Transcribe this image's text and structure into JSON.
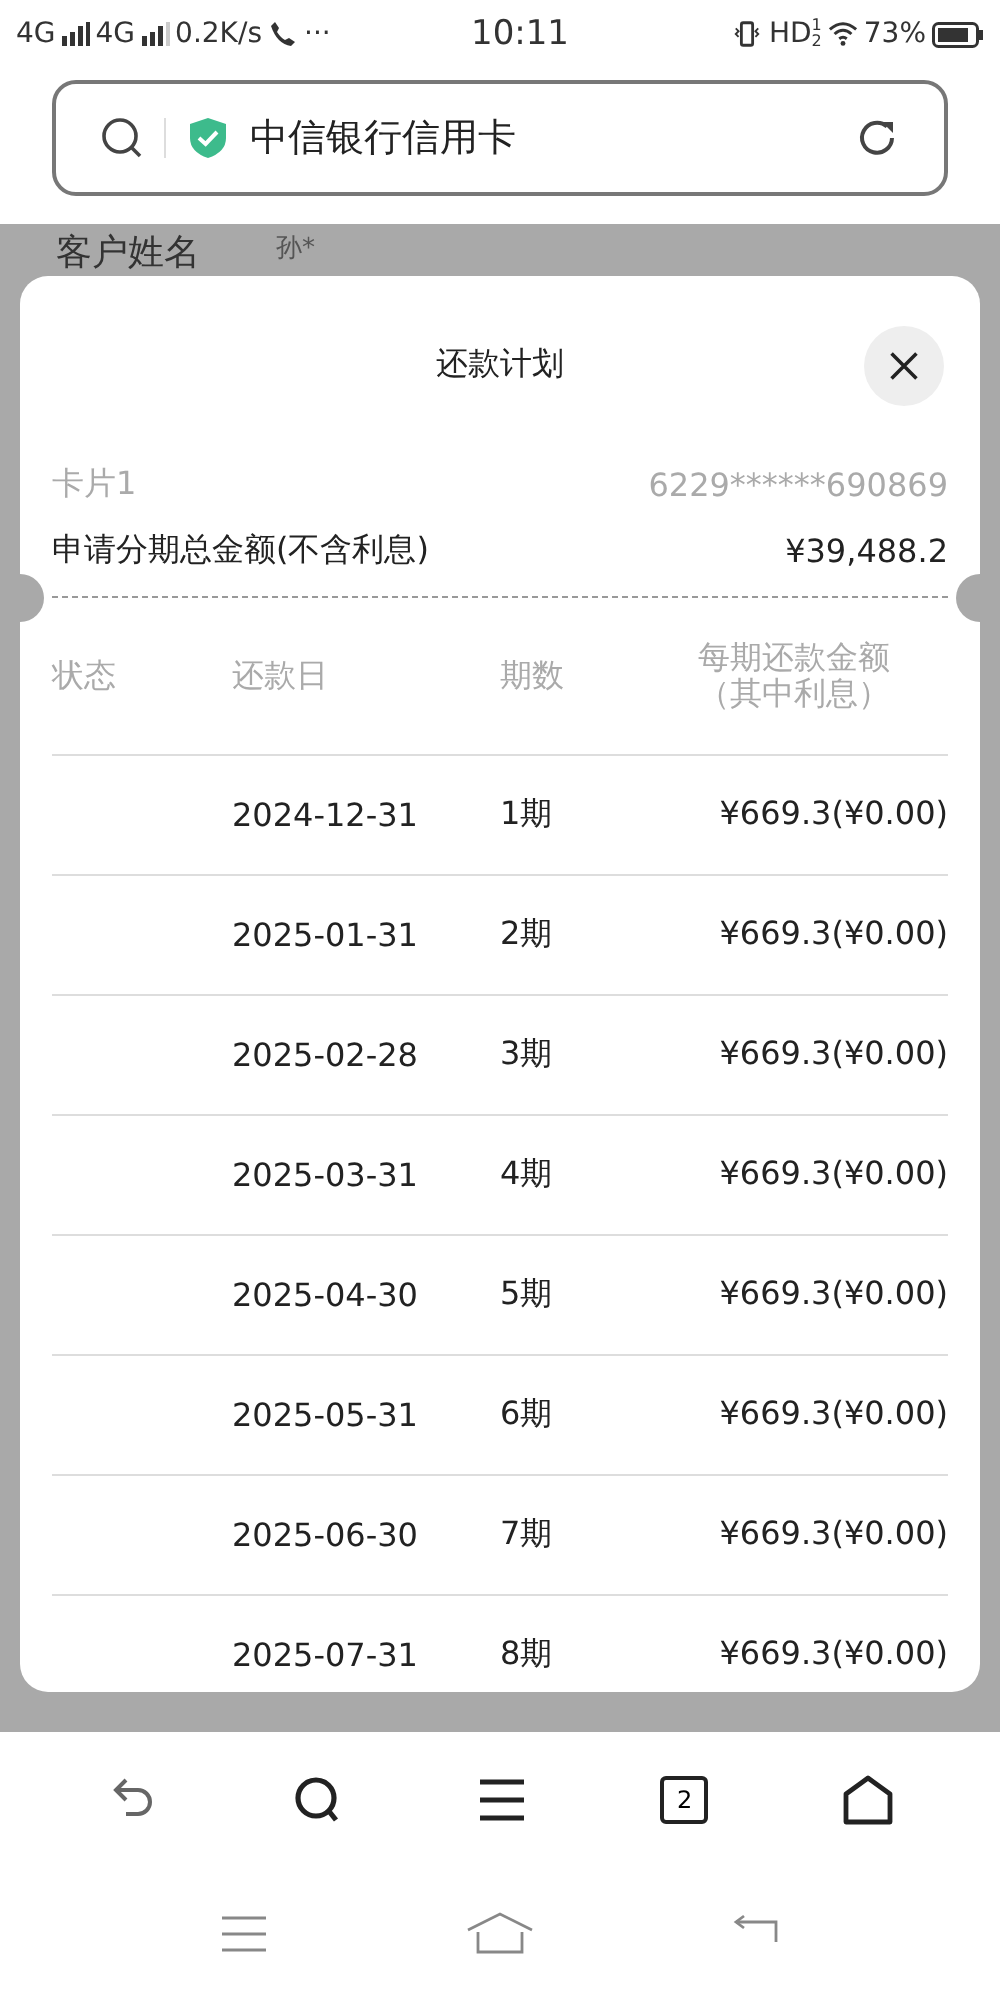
{
  "status_bar": {
    "network_1": "4G",
    "network_2": "4G",
    "speed": "0.2K/s",
    "more": "···",
    "time": "10:11",
    "hd": "HD",
    "hd_sup": "1",
    "hd_sub": "2",
    "battery": "73%"
  },
  "address_bar": {
    "title": "中信银行信用卡"
  },
  "background": {
    "label": "客户姓名",
    "value": "孙*"
  },
  "sheet": {
    "title": "还款计划",
    "card_label": "卡片1",
    "card_number": "6229******690869",
    "total_label": "申请分期总金额(不含利息)",
    "total_value": "¥39,488.2",
    "columns": [
      "状态",
      "还款日",
      "期数",
      "每期还款金额"
    ],
    "amount_note": "（其中利息）",
    "rows": [
      {
        "date": "2024-12-31",
        "period": "1期",
        "amount": "¥669.3(¥0.00)"
      },
      {
        "date": "2025-01-31",
        "period": "2期",
        "amount": "¥669.3(¥0.00)"
      },
      {
        "date": "2025-02-28",
        "period": "3期",
        "amount": "¥669.3(¥0.00)"
      },
      {
        "date": "2025-03-31",
        "period": "4期",
        "amount": "¥669.3(¥0.00)"
      },
      {
        "date": "2025-04-30",
        "period": "5期",
        "amount": "¥669.3(¥0.00)"
      },
      {
        "date": "2025-05-31",
        "period": "6期",
        "amount": "¥669.3(¥0.00)"
      },
      {
        "date": "2025-06-30",
        "period": "7期",
        "amount": "¥669.3(¥0.00)"
      },
      {
        "date": "2025-07-31",
        "period": "8期",
        "amount": "¥669.3(¥0.00)"
      }
    ]
  },
  "toolbar": {
    "tab_count": "2"
  }
}
